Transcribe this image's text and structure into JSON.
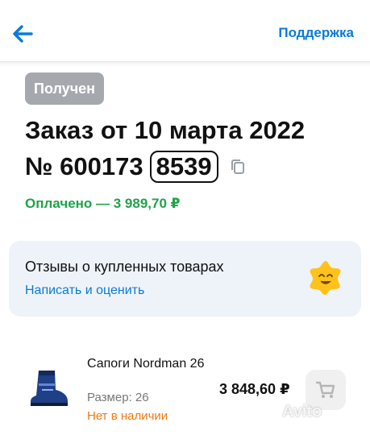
{
  "header": {
    "support_label": "Поддержка"
  },
  "order": {
    "status": "Получен",
    "title_line1": "Заказ от 10 марта 2022",
    "number_prefix": "№ 600173",
    "number_suffix": "8539",
    "paid_text": "Оплачено — 3 989,70 ₽"
  },
  "reviews": {
    "title": "Отзывы о купленных товарах",
    "link": "Написать и оценить"
  },
  "product": {
    "name": "Сапоги Nordman 26",
    "size": "Размер: 26",
    "availability": "Нет в наличии",
    "price": "3 848,60 ₽"
  },
  "watermark": "Avito",
  "colors": {
    "accent": "#0a7bd9",
    "paid": "#1fa34a",
    "out_of_stock": "#f07a10",
    "status_badge": "#a5a8ad"
  },
  "icons": [
    "back-arrow-icon",
    "copy-icon",
    "star-smile-icon",
    "cart-icon",
    "boot-product-image"
  ]
}
